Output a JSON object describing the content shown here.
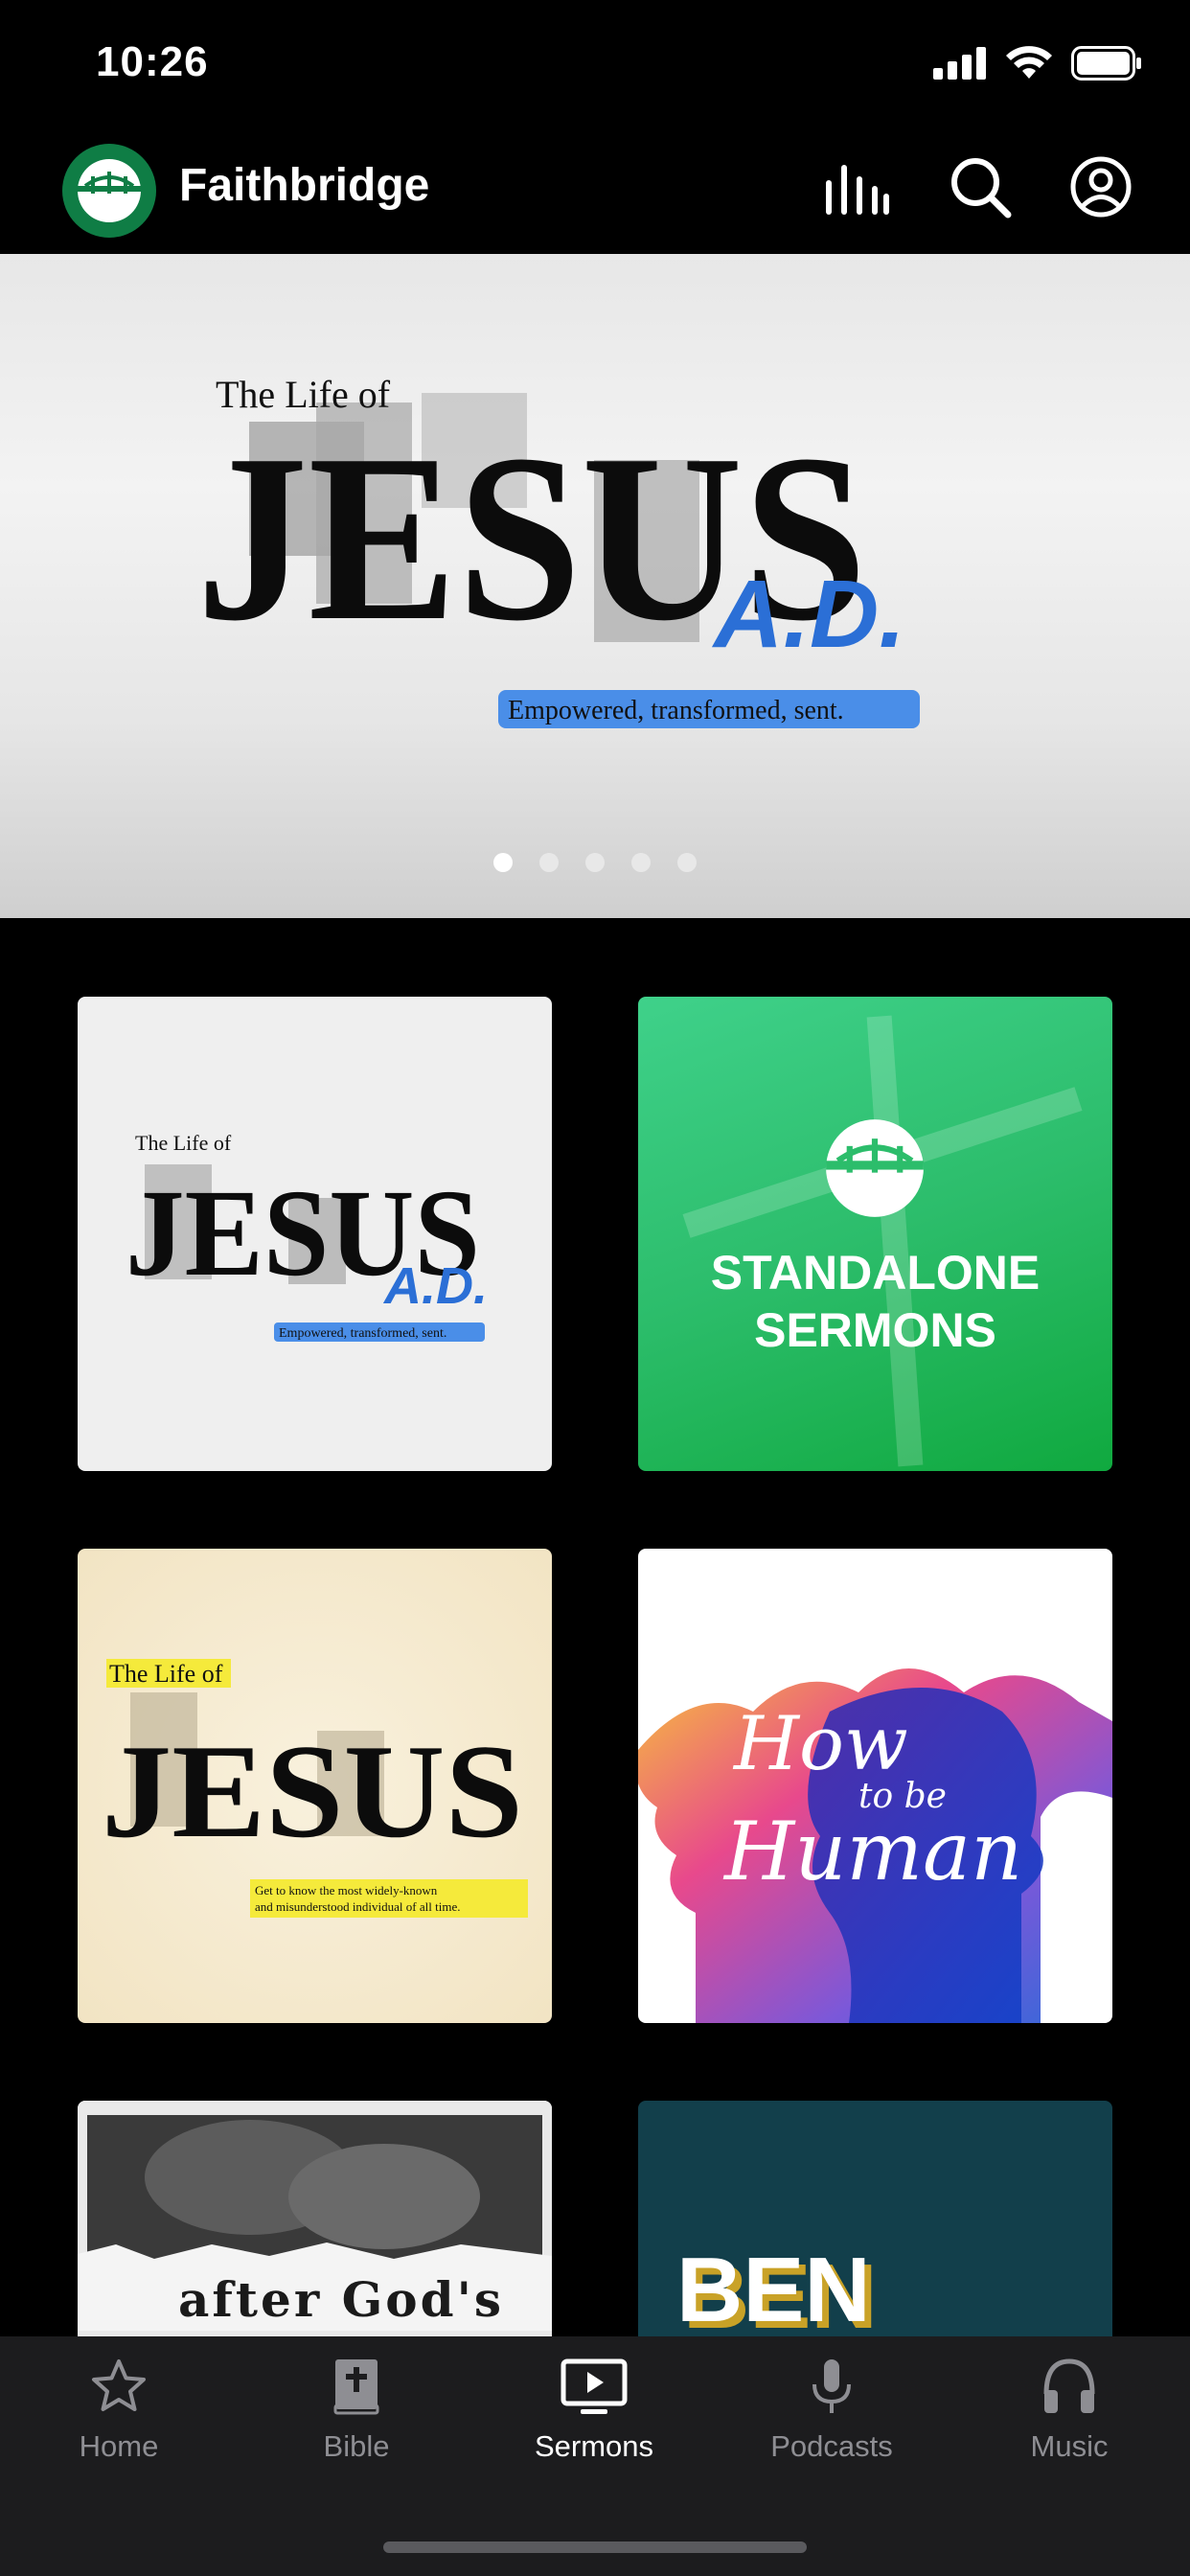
{
  "status_bar": {
    "time": "10:26"
  },
  "header": {
    "brand": "Faithbridge"
  },
  "hero": {
    "title_small": "The Life of",
    "title_big": "JESUS",
    "title_accent": "A.D.",
    "tagline": "Empowered, transformed, sent.",
    "page_count": 5,
    "active_page": 1
  },
  "tiles": [
    {
      "small": "The Life of",
      "big": "JESUS",
      "accent": "A.D.",
      "tagline": "Empowered, transformed, sent."
    },
    {
      "line1": "STANDALONE",
      "line2": "SERMONS"
    },
    {
      "small": "The Life of",
      "big": "JESUS",
      "line1": "Get to know the most widely-known",
      "line2": "and misunderstood individual of all time."
    },
    {
      "line1": "How",
      "line2": "to be",
      "line3": "Human"
    },
    {
      "text": "after God's"
    },
    {
      "text": "BEN"
    }
  ],
  "tabs": [
    {
      "label": "Home",
      "icon": "star-icon"
    },
    {
      "label": "Bible",
      "icon": "bible-icon"
    },
    {
      "label": "Sermons",
      "icon": "sermons-icon",
      "active": true
    },
    {
      "label": "Podcasts",
      "icon": "microphone-icon"
    },
    {
      "label": "Music",
      "icon": "headphones-icon"
    }
  ],
  "colors": {
    "brand_green": "#0f7d45",
    "accent_blue": "#2b6fd6",
    "tab_bg": "#1c1c1e"
  }
}
